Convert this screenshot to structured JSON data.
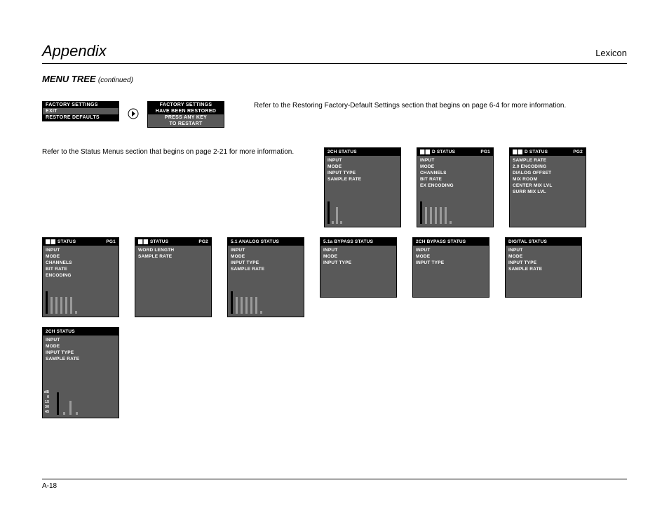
{
  "header": {
    "title": "Appendix",
    "brand": "Lexicon"
  },
  "subtitle": {
    "main": "MENU TREE",
    "suffix": "(continued)"
  },
  "factory_box1": {
    "r1": "FACTORY  SETTINGS",
    "r2": "EXIT",
    "r3": "RESTORE  DEFAULTS"
  },
  "factory_box2": {
    "r1": "FACTORY  SETTINGS",
    "r2": "HAVE  BEEN  RESTORED",
    "r3": "PRESS  ANY  KEY",
    "r4": "TO  RESTART"
  },
  "note1": "Refer to the Restoring Factory-Default Settings section that begins on page 6-4 for more information.",
  "note2": "Refer to the Status Menus section that begins on page 2-21 for more information.",
  "panels_r2": [
    {
      "title": "2CH STATUS",
      "pg": "",
      "lines": [
        "INPUT",
        "MODE",
        "INPUT TYPE",
        "SAMPLE RATE"
      ],
      "bars": true,
      "icon": false
    },
    {
      "title": "D STATUS",
      "pg": "PG1",
      "lines": [
        "INPUT",
        "MODE",
        "CHANNELS",
        "BIT RATE",
        "EX ENCODING"
      ],
      "bars": true,
      "icon": true
    },
    {
      "title": "D STATUS",
      "pg": "PG2",
      "lines": [
        "SAMPLE RATE",
        "2.0 ENCODING",
        "DIALOG OFFSET",
        "MIX ROOM",
        "CENTER MIX LVL",
        "SURR MIX LVL"
      ],
      "bars": false,
      "icon": true
    }
  ],
  "panels_r3": [
    {
      "title": "STATUS",
      "pg": "PG1",
      "lines": [
        "INPUT",
        "MODE",
        "CHANNELS",
        "BIT RATE",
        "    ENCODING"
      ],
      "bars": true,
      "icon": true,
      "prefix_icon": true
    },
    {
      "title": "STATUS",
      "pg": "PG2",
      "lines": [
        "WORD LENGTH",
        "SAMPLE RATE"
      ],
      "bars": false,
      "icon": true,
      "prefix_icon": true
    },
    {
      "title": "5.1 ANALOG STATUS",
      "pg": "",
      "lines": [
        "INPUT",
        "MODE",
        "INPUT TYPE",
        "SAMPLE RATE"
      ],
      "bars": true,
      "icon": false
    },
    {
      "title": "5.1a  BYPASS STATUS",
      "pg": "",
      "lines": [
        "INPUT",
        "MODE",
        "INPUT TYPE"
      ],
      "bars": false,
      "icon": false,
      "short": true
    },
    {
      "title": "2CH BYPASS STATUS",
      "pg": "",
      "lines": [
        "INPUT",
        "MODE",
        "INPUT TYPE"
      ],
      "bars": false,
      "icon": false,
      "short": true
    },
    {
      "title": "DIGITAL STATUS",
      "pg": "",
      "lines": [
        "INPUT",
        "MODE",
        "INPUT TYPE",
        "SAMPLE RATE"
      ],
      "bars": false,
      "icon": false,
      "short": true
    }
  ],
  "panel_r4": {
    "title": "2CH STATUS",
    "lines": [
      "INPUT",
      "MODE",
      "INPUT TYPE",
      "SAMPLE RATE"
    ],
    "scale": [
      "dB",
      "0",
      "15",
      "30",
      "45"
    ]
  },
  "footer": {
    "page": "A-18"
  }
}
